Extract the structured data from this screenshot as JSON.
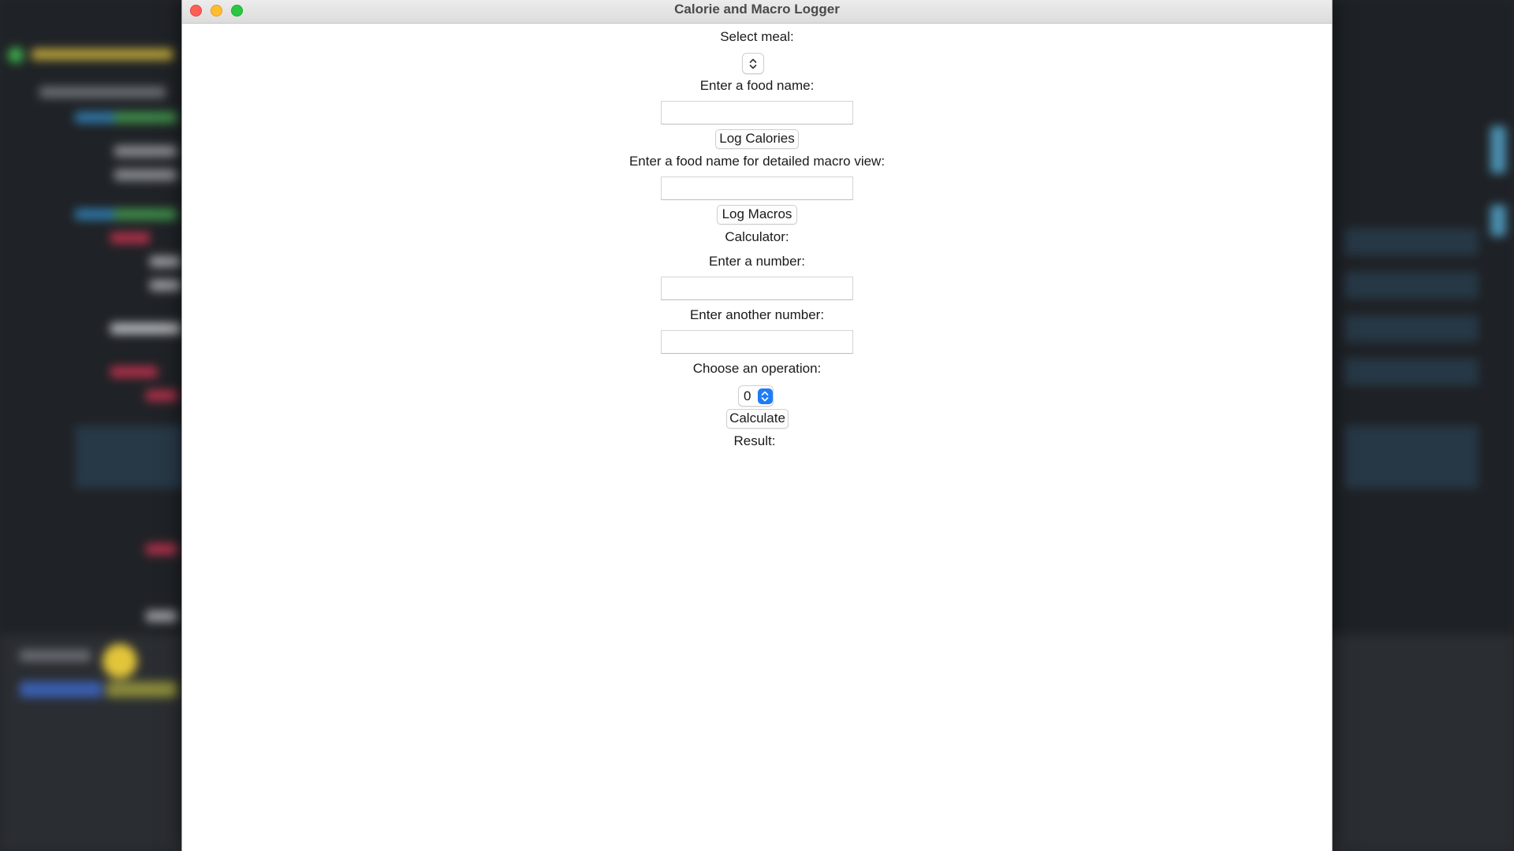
{
  "window": {
    "title": "Calorie and Macro Logger"
  },
  "form": {
    "select_meal_label": "Select meal:",
    "meal_value": "",
    "food_name_label": "Enter a food name:",
    "food_name_value": "",
    "log_calories_button": "Log Calories",
    "macro_food_label": "Enter a food name for detailed macro view:",
    "macro_food_value": "",
    "log_macros_button": "Log Macros"
  },
  "calculator": {
    "heading": "Calculator:",
    "number1_label": "Enter a number:",
    "number1_value": "",
    "number2_label": "Enter another number:",
    "number2_value": "",
    "operation_label": "Choose an operation:",
    "operation_value": "0",
    "calculate_button": "Calculate",
    "result_label": "Result:"
  },
  "colors": {
    "close": "#fe5f57",
    "minimize": "#febc2e",
    "maximize": "#28c840",
    "select_accent": "#1f7cf7"
  }
}
